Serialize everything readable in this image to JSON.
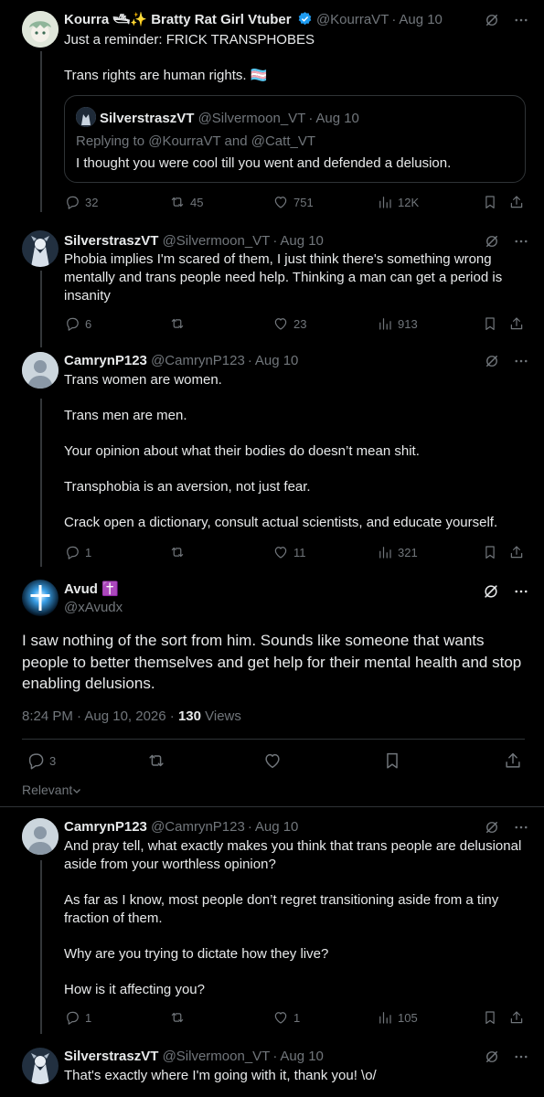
{
  "posts": {
    "p1": {
      "name": "Kourra 🛥✨ Bratty Rat Girl Vtuber",
      "handle": "@KourraVT",
      "date": "Aug 10",
      "lines": [
        "Just a reminder: FRICK TRANSPHOBES",
        "Trans rights are human rights. 🏳️‍⚧️"
      ],
      "quote": {
        "name": "SilverstraszVT",
        "handle": "@Silvermoon_VT",
        "date": "Aug 10",
        "replying_prefix": "Replying to",
        "replying_to_1": "@KourraVT",
        "replying_and": "and",
        "replying_to_2": "@Catt_VT",
        "text": "I thought you were cool till you went and defended a delusion."
      },
      "replies": "32",
      "reposts": "45",
      "likes": "751",
      "views": "12K"
    },
    "p2": {
      "name": "SilverstraszVT",
      "handle": "@Silvermoon_VT",
      "date": "Aug 10",
      "text": "Phobia implies I'm scared of them, I just think there's something wrong mentally and trans people need help. Thinking a man can get a period is insanity",
      "replies": "6",
      "reposts": "",
      "likes": "23",
      "views": "913"
    },
    "p3": {
      "name": "CamrynP123",
      "handle": "@CamrynP123",
      "date": "Aug 10",
      "lines": [
        "Trans women are women.",
        "Trans men are men.",
        "Your opinion about what their bodies do doesn’t mean shit.",
        "Transphobia is an aversion, not just fear.",
        "Crack open a dictionary, consult actual scientists, and educate yourself."
      ],
      "replies": "1",
      "reposts": "",
      "likes": "11",
      "views": "321"
    },
    "main": {
      "name": "Avud",
      "name_emoji": "✝️",
      "handle": "@xAvudx",
      "text": "I saw nothing of the sort from him. Sounds like someone that wants people to better themselves and get help for their mental health and stop enabling delusions.",
      "time": "8:24 PM · Aug 10, 2026 · ",
      "views_count": "130",
      "views_label": " Views",
      "replies": "3",
      "sort_label": "Relevant"
    },
    "p4": {
      "name": "CamrynP123",
      "handle": "@CamrynP123",
      "date": "Aug 10",
      "lines": [
        "And pray tell, what exactly makes you think that trans people are delusional aside from your worthless opinion?",
        "As far as I know, most people don’t regret transitioning aside from a tiny fraction of them.",
        "Why are you trying to dictate how they live?",
        "How is it affecting you?"
      ],
      "replies": "1",
      "reposts": "",
      "likes": "1",
      "views": "105"
    },
    "p5": {
      "name": "SilverstraszVT",
      "handle": "@Silvermoon_VT",
      "date": "Aug 10",
      "text": "That's exactly where I'm going with it, thank you! \\o/"
    }
  },
  "colors": {
    "background": "#000000",
    "text": "#e7e9ea",
    "muted": "#71767b",
    "border": "#2f3336",
    "verified": "#1d9bf0"
  }
}
